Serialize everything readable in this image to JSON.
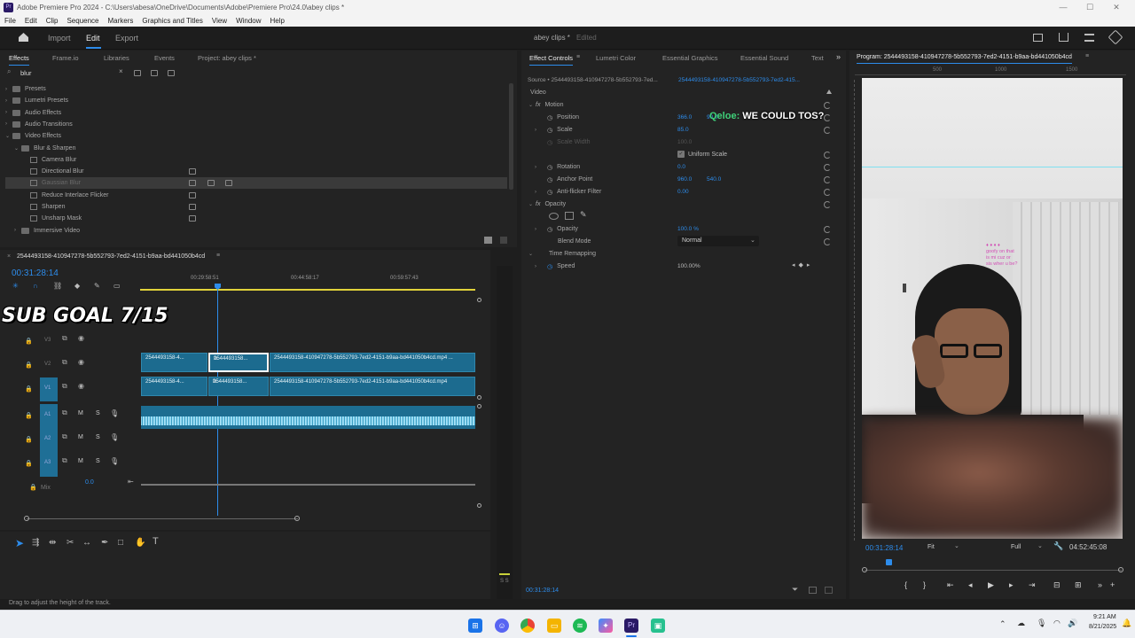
{
  "window": {
    "app_icon": "Pr",
    "title": "Adobe Premiere Pro 2024 - C:\\Users\\abesa\\OneDrive\\Documents\\Adobe\\Premiere Pro\\24.0\\abey clips *",
    "controls": {
      "minimize": "—",
      "maximize": "☐",
      "close": "✕"
    }
  },
  "menu": [
    "File",
    "Edit",
    "Clip",
    "Sequence",
    "Markers",
    "Graphics and Titles",
    "View",
    "Window",
    "Help"
  ],
  "header": {
    "tabs": [
      "Import",
      "Edit",
      "Export"
    ],
    "active": "Edit",
    "project_title": "abey clips *",
    "edited": "Edited"
  },
  "effects_panel": {
    "tabs": [
      "Effects",
      "Frame.io",
      "Libraries",
      "Events",
      "Project: abey clips *"
    ],
    "search_value": "blur",
    "tree": [
      {
        "label": "Presets",
        "kind": "folder",
        "indent": 0
      },
      {
        "label": "Lumetri Presets",
        "kind": "folder",
        "indent": 0
      },
      {
        "label": "Audio Effects",
        "kind": "folder",
        "indent": 0
      },
      {
        "label": "Audio Transitions",
        "kind": "folder",
        "indent": 0
      },
      {
        "label": "Video Effects",
        "kind": "folder",
        "indent": 0,
        "open": true
      },
      {
        "label": "Blur & Sharpen",
        "kind": "folder",
        "indent": 1,
        "open": true
      },
      {
        "label": "Camera Blur",
        "kind": "fx",
        "indent": 2
      },
      {
        "label": "Directional Blur",
        "kind": "fx",
        "indent": 2
      },
      {
        "label": "Gaussian Blur",
        "kind": "fx",
        "indent": 2,
        "selected": true
      },
      {
        "label": "Reduce Interlace Flicker",
        "kind": "fx",
        "indent": 2
      },
      {
        "label": "Sharpen",
        "kind": "fx",
        "indent": 2
      },
      {
        "label": "Unsharp Mask",
        "kind": "fx",
        "indent": 2
      },
      {
        "label": "Immersive Video",
        "kind": "folder",
        "indent": 1
      }
    ]
  },
  "effect_controls": {
    "tabs": [
      "Effect Controls",
      "Lumetri Color",
      "Essential Graphics",
      "Essential Sound",
      "Text"
    ],
    "source": "Source • 2544493158-410947278-5b552793-7ed...",
    "sequence": "2544493158-410947278-5b552793-7ed2-415...",
    "section_video": "Video",
    "motion": "Motion",
    "position": {
      "label": "Position",
      "x": "366.0",
      "y": "90.0"
    },
    "scale": {
      "label": "Scale",
      "value": "85.0"
    },
    "scale_width": {
      "label": "Scale Width",
      "value": "100.0"
    },
    "uniform_scale": "Uniform Scale",
    "rotation": {
      "label": "Rotation",
      "value": "0.0"
    },
    "anchor": {
      "label": "Anchor Point",
      "x": "960.0",
      "y": "540.0"
    },
    "antiflicker": {
      "label": "Anti-flicker Filter",
      "value": "0.00"
    },
    "opacity_section": "Opacity",
    "opacity": {
      "label": "Opacity",
      "value": "100.0 %"
    },
    "blend": {
      "label": "Blend Mode",
      "value": "Normal"
    },
    "time_remap": "Time Remapping",
    "speed": {
      "label": "Speed",
      "value": "100.00%"
    },
    "footer_time": "00:31:28:14"
  },
  "timeline": {
    "sequence_name": "2544493158-410947278-5b552793-7ed2-4151-b9aa-bd441050b4cd",
    "timecode": "00:31:28:14",
    "ruler": [
      "00:29:58:51",
      "00:44:58:17",
      "00:59:57:43"
    ],
    "overlay_text": "SUB GOAL 7/15",
    "tracks_video": [
      "V3",
      "V2",
      "V1"
    ],
    "tracks_audio": [
      "A1",
      "A2",
      "A3"
    ],
    "mix": {
      "label": "Mix",
      "value": "0.0"
    },
    "clips_v2": [
      "2544493158-4...",
      "2544493158...",
      "2544493158-410947278-5b552793-7ed2-4151-b9aa-bd441050b4cd.mp4 ..."
    ],
    "clips_v1": [
      "2544493158-4...",
      "2544493158...",
      "2544493158-410947278-5b552793-7ed2-4151-b9aa-bd441050b4cd.mp4"
    ],
    "fx_badge": "fx",
    "track_m": "M",
    "track_s": "S",
    "meter_label": "S S"
  },
  "program": {
    "title": "Program: 2544493158-410947278-5b552793-7ed2-4151-b9aa-bd441050b4cd",
    "ruler": [
      "500",
      "1000",
      "1500"
    ],
    "timecode": "00:31:28:14",
    "fit": "Fit",
    "quality": "Full",
    "duration": "04:52:45:08",
    "caption_name": "Qeloe:",
    "caption_text": "WE COULD TOS?",
    "chat": [
      "♦ ♦ ♦ ♦",
      "goofy on that",
      "is mi cuz or",
      "sis wher u be?"
    ]
  },
  "status_text": "Drag to adjust the height of the track.",
  "taskbar": {
    "time": "9:21 AM",
    "date": "8/21/2025",
    "apps": [
      "windows-start",
      "discord",
      "chrome",
      "file-explorer",
      "spotify",
      "copilot",
      "premiere-pro",
      "streamlabs"
    ]
  }
}
